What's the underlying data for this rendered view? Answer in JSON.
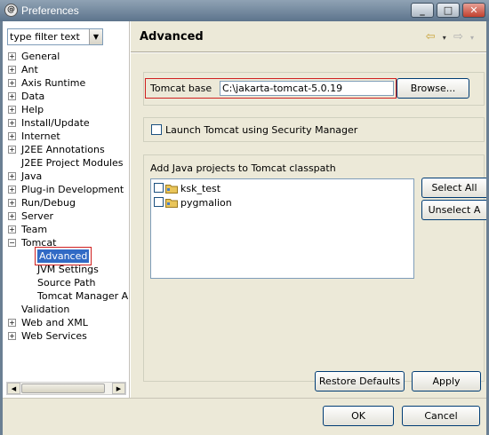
{
  "window": {
    "title": "Preferences",
    "minimize_label": "_",
    "maximize_label": "□",
    "close_label": "✕"
  },
  "left": {
    "filter_text": "type filter text",
    "tree": [
      {
        "label": "General",
        "expander": "+"
      },
      {
        "label": "Ant",
        "expander": "+"
      },
      {
        "label": "Axis Runtime",
        "expander": "+"
      },
      {
        "label": "Data",
        "expander": "+"
      },
      {
        "label": "Help",
        "expander": "+"
      },
      {
        "label": "Install/Update",
        "expander": "+"
      },
      {
        "label": "Internet",
        "expander": "+"
      },
      {
        "label": "J2EE Annotations",
        "expander": "+"
      },
      {
        "label": "J2EE Project Modules",
        "expander": ""
      },
      {
        "label": "Java",
        "expander": "+"
      },
      {
        "label": "Plug-in Development",
        "expander": "+"
      },
      {
        "label": "Run/Debug",
        "expander": "+"
      },
      {
        "label": "Server",
        "expander": "+"
      },
      {
        "label": "Team",
        "expander": "+"
      },
      {
        "label": "Tomcat",
        "expander": "−"
      },
      {
        "label": "Advanced",
        "expander": "",
        "child": true,
        "selected": true
      },
      {
        "label": "JVM Settings",
        "expander": "",
        "child": true
      },
      {
        "label": "Source Path",
        "expander": "",
        "child": true
      },
      {
        "label": "Tomcat Manager A",
        "expander": "",
        "child": true
      },
      {
        "label": "Validation",
        "expander": ""
      },
      {
        "label": "Web and XML",
        "expander": "+"
      },
      {
        "label": "Web Services",
        "expander": "+"
      }
    ]
  },
  "page": {
    "title": "Advanced",
    "tomcat_base": {
      "label": "Tomcat base",
      "value": "C:\\jakarta-tomcat-5.0.19",
      "browse_label": "Browse..."
    },
    "security": {
      "label": "Launch Tomcat using Security Manager",
      "checked": false
    },
    "classpath": {
      "label": "Add Java projects to Tomcat classpath",
      "projects": [
        {
          "name": "ksk_test",
          "checked": false
        },
        {
          "name": "pygmalion",
          "checked": false
        }
      ],
      "select_all_label": "Select All",
      "unselect_all_label": "Unselect A"
    },
    "restore_defaults_label": "Restore Defaults",
    "apply_label": "Apply"
  },
  "footer": {
    "ok_label": "OK",
    "cancel_label": "Cancel"
  }
}
